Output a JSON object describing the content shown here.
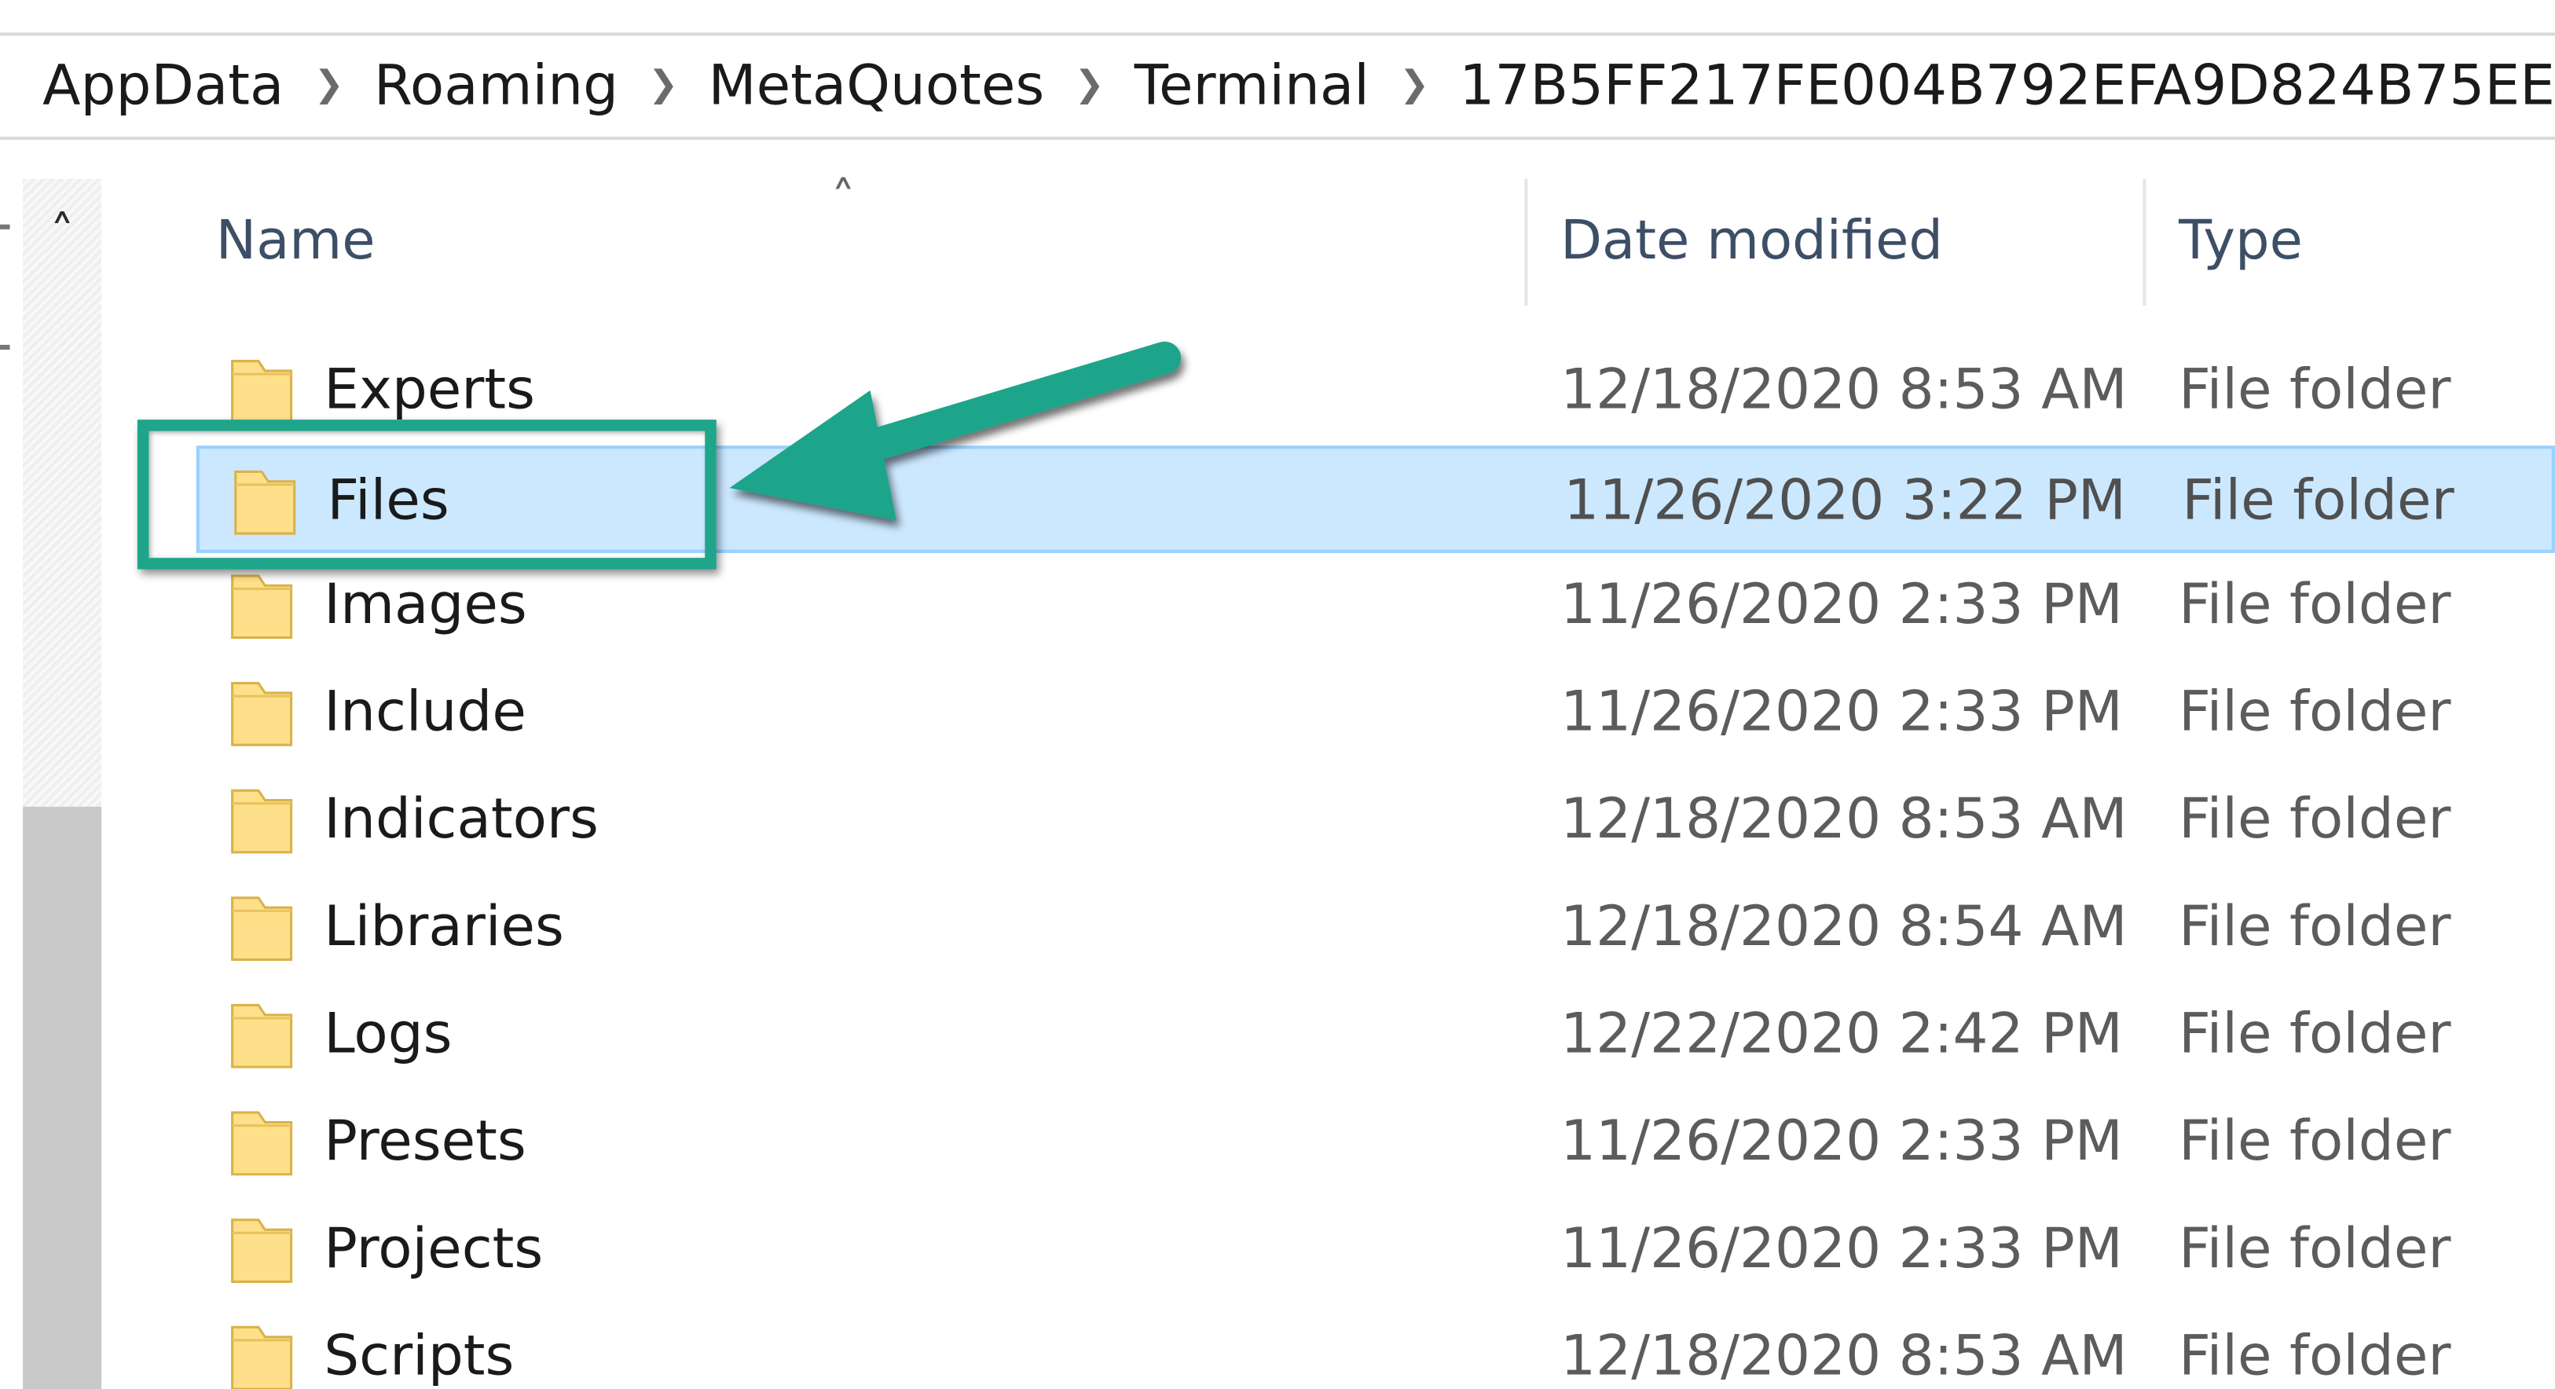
{
  "breadcrumb": {
    "items": [
      "AppData",
      "Roaming",
      "MetaQuotes",
      "Terminal",
      "17B5FF217FE004B792EFA9D824B75EE"
    ]
  },
  "columns": {
    "name": "Name",
    "date_modified": "Date modified",
    "type": "Type"
  },
  "files": [
    {
      "name": "Experts",
      "date": "12/18/2020 8:53 AM",
      "type": "File folder"
    },
    {
      "name": "Files",
      "date": "11/26/2020 3:22 PM",
      "type": "File folder",
      "selected": true
    },
    {
      "name": "Images",
      "date": "11/26/2020 2:33 PM",
      "type": "File folder"
    },
    {
      "name": "Include",
      "date": "11/26/2020 2:33 PM",
      "type": "File folder"
    },
    {
      "name": "Indicators",
      "date": "12/18/2020 8:53 AM",
      "type": "File folder"
    },
    {
      "name": "Libraries",
      "date": "12/18/2020 8:54 AM",
      "type": "File folder"
    },
    {
      "name": "Logs",
      "date": "12/22/2020 2:42 PM",
      "type": "File folder"
    },
    {
      "name": "Presets",
      "date": "11/26/2020 2:33 PM",
      "type": "File folder"
    },
    {
      "name": "Projects",
      "date": "11/26/2020 2:33 PM",
      "type": "File folder"
    },
    {
      "name": "Scripts",
      "date": "12/18/2020 8:53 AM",
      "type": "File folder"
    }
  ],
  "icons": {
    "breadcrumb_separator": "chevron-right-icon",
    "sort_indicator": "chevron-up-icon",
    "nav_scroll_up": "chevron-up-icon",
    "folder": "folder-icon",
    "annotation_arrow": "arrow-icon"
  },
  "colors": {
    "selection_fill": "#cce8ff",
    "selection_border": "#99d1ff",
    "annotation": "#1fa58a",
    "folder_fill": "#ffe08a",
    "header_text": "#3d4f66"
  }
}
